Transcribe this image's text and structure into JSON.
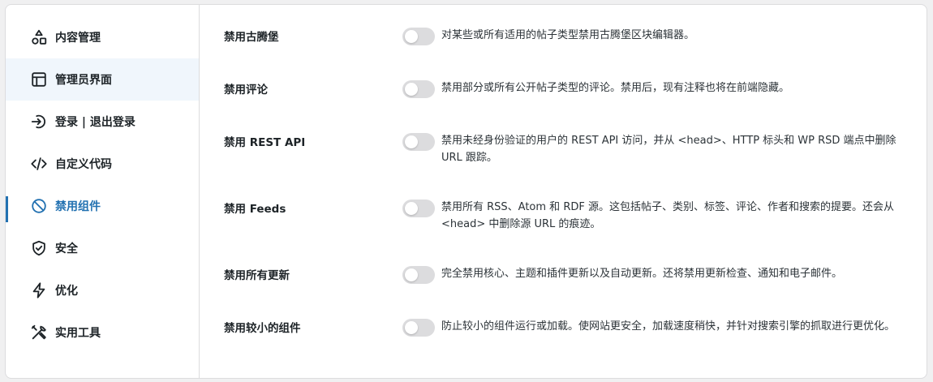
{
  "sidebar": {
    "items": [
      {
        "label": "内容管理",
        "icon": "shapes-icon"
      },
      {
        "label": "管理员界面",
        "icon": "layout-icon"
      },
      {
        "label": "登录 | 退出登录",
        "icon": "login-icon"
      },
      {
        "label": "自定义代码",
        "icon": "code-icon"
      },
      {
        "label": "禁用组件",
        "icon": "ban-icon"
      },
      {
        "label": "安全",
        "icon": "shield-check-icon"
      },
      {
        "label": "优化",
        "icon": "lightning-icon"
      },
      {
        "label": "实用工具",
        "icon": "tools-icon"
      }
    ],
    "hover_index": 1,
    "active_index": 4
  },
  "settings": [
    {
      "label": "禁用古腾堡",
      "enabled": false,
      "description": "对某些或所有适用的帖子类型禁用古腾堡区块编辑器。"
    },
    {
      "label": "禁用评论",
      "enabled": false,
      "description": "禁用部分或所有公开帖子类型的评论。禁用后，现有注释也将在前端隐藏。"
    },
    {
      "label": "禁用 REST API",
      "enabled": false,
      "description": "禁用未经身份验证的用户的 REST API 访问，并从 <head>、HTTP 标头和 WP RSD 端点中删除 URL 跟踪。"
    },
    {
      "label": "禁用 Feeds",
      "enabled": false,
      "description": "禁用所有 RSS、Atom 和 RDF 源。这包括帖子、类别、标签、评论、作者和搜索的提要。还会从 <head> 中删除源 URL 的痕迹。"
    },
    {
      "label": "禁用所有更新",
      "enabled": false,
      "description": "完全禁用核心、主题和插件更新以及自动更新。还将禁用更新检查、通知和电子邮件。"
    },
    {
      "label": "禁用较小的组件",
      "enabled": false,
      "description": "防止较小的组件运行或加载。使网站更安全，加载速度稍快，并针对搜索引擎的抓取进行更优化。"
    }
  ],
  "colors": {
    "accent": "#2271b1",
    "hover_bg": "#f0f6fc",
    "toggle_off": "#dcdcde"
  }
}
